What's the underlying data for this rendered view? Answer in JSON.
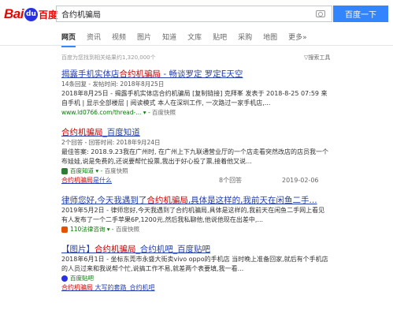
{
  "logo": {
    "bai": "Bai",
    "paw": "du",
    "cn": "百度"
  },
  "search": {
    "query": "合约机骗局",
    "button": "百度一下"
  },
  "tabs": [
    {
      "label": "网页"
    },
    {
      "label": "资讯"
    },
    {
      "label": "视频"
    },
    {
      "label": "图片"
    },
    {
      "label": "知道"
    },
    {
      "label": "文库"
    },
    {
      "label": "贴吧"
    },
    {
      "label": "采购"
    },
    {
      "label": "地图"
    },
    {
      "label": "更多»"
    }
  ],
  "count_text": "百度为您找到相关结果约1,320,000个",
  "tools_label": "搜索工具",
  "results": [
    {
      "title_pre": "揭露手机实体店",
      "title_hl": "合约机骗局",
      "title_post": " - 畅谈罗定 罗定E天空",
      "meta": "14条回复 - 发帖时间: 2018年8月25日",
      "abstract": "2018年8月25日 - 揭露手机实体店合约机骗局 [复制链接] 克拜峯 发表于 2018-8-25 07:59 来自手机 | 显示全部楼层 | 阅读模式 本人在深圳工作, 一次路过一家手机店,...",
      "url": "www.ld0766.com/thread-... ▾",
      "snapshot": "百度快照"
    },
    {
      "title_pre": "",
      "title_hl": "合约机骗局",
      "title_post": "_百度知道",
      "meta": "2个回答 - 回答时间: 2018年9月24日",
      "abstract": "最佳答案: 2018.9.23我在广州时, 在广州上下九联通营业厅的一个店走看突然改店的店员我一个布娃娃,说是免费的,还说要帮忙投票,我出于好心投了票,接着他又说...",
      "sub_source": "百度知道 ▾",
      "sub_snapshot": "百度快照",
      "sub_link_hl": "合约机骗局",
      "sub_link_post": "是什么",
      "sub_answers": "8个回答",
      "sub_date": "2019-02-06"
    },
    {
      "title_pre": "律师您好,今天我遇到了",
      "title_hl": "合约机骗局",
      "title_post": ",具体是这样的,我前天在闲鱼二手...",
      "abstract": "2019年5月2日 - 律师您好,今天我遇到了合约机骗局,具体是这样的,我前天在闲鱼二手网上看见有人发布了一个二手苹果6P,1200元,然后我私聊他,他说他现在出差中,...",
      "sub_source": "110法律咨询 ▾",
      "sub_snapshot": "百度快照"
    },
    {
      "title_pre": "【图片】",
      "title_hl": "合约机骗局",
      "title_post": "_合约机吧_百度贴吧",
      "abstract": "2018年6月1日 - 坐标东莞市永盛大街卖vivo oppo的手机店 当时晚上准备回家,就后有个手机店的人员过来和我说帮个忙,说搞工作不易,就差两个表要填,我一看...",
      "sub_source": "百度贴吧",
      "sub_link_hl": "合约机骗局",
      "sub_link_post": " 大写的套路_合约机吧"
    }
  ]
}
